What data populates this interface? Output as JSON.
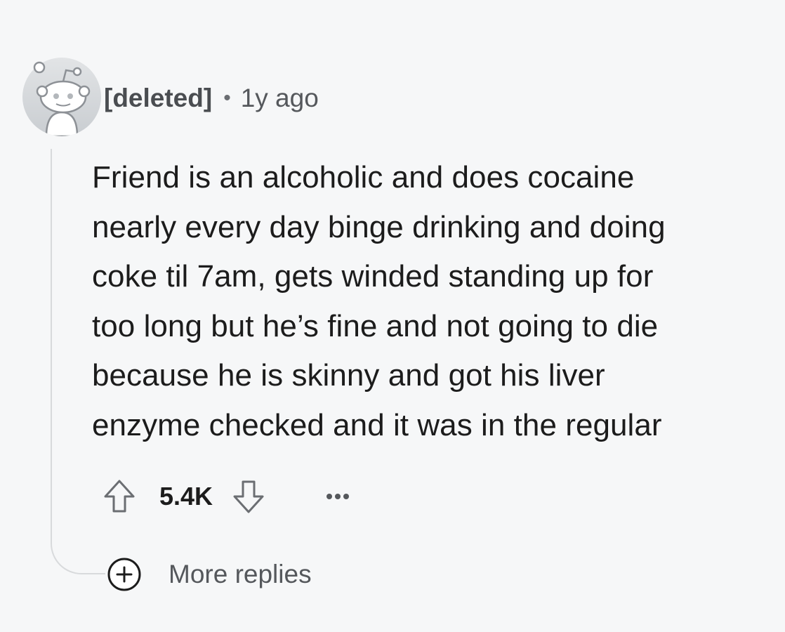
{
  "comment": {
    "author": "[deleted]",
    "separator": "•",
    "age": "1y ago",
    "avatar_icon": "reddit-snoo-icon",
    "body_lines": [
      "Friend is an alcoholic and does cocaine",
      "nearly every day binge drinking and doing",
      "coke til 7am, gets winded standing up for",
      "too long but he’s fine and not going to die",
      "because he is skinny and got his liver",
      "enzyme checked and it was in the regular"
    ],
    "score": "5.4K",
    "upvote_icon": "upvote-arrow-icon",
    "downvote_icon": "downvote-arrow-icon",
    "overflow_icon": "ellipsis-icon"
  },
  "replies": {
    "more_label": "More replies",
    "expand_icon": "plus-circle-icon"
  },
  "colors": {
    "background": "#f6f7f8",
    "text": "#1c1c1c",
    "muted": "#55585c",
    "thread_line": "#d8dadc"
  }
}
